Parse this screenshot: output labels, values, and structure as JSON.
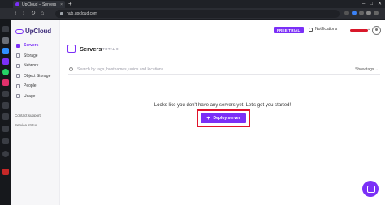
{
  "browser": {
    "tab_title": "UpCloud – Servers",
    "tab_close": "×",
    "new_tab": "+",
    "url": "hub.upcloud.com",
    "win_minimize": "–",
    "win_maximize": "□",
    "win_close": "✕",
    "back": "‹",
    "forward": "›",
    "reload": "↻",
    "home": "⌂"
  },
  "sidebar": {
    "brand": "UpCloud",
    "items": [
      {
        "label": "Servers",
        "active": true
      },
      {
        "label": "Storage",
        "active": false
      },
      {
        "label": "Network",
        "active": false
      },
      {
        "label": "Object Storage",
        "active": false
      },
      {
        "label": "People",
        "active": false
      },
      {
        "label": "Usage",
        "active": false
      }
    ],
    "contact": "Contact support",
    "status": "Service status"
  },
  "header": {
    "badge": "FREE TRIAL",
    "notifications": "Notifications",
    "chevron": "⌄"
  },
  "main": {
    "title": "Servers",
    "total": "TOTAL 0",
    "search_placeholder": "Search by tags, hostnames, uuids and locations",
    "show_tags": "Show tags ⌄",
    "empty_message": "Looks like you don't have any servers yet. Let's get you started!",
    "deploy_label": "Deploy server",
    "deploy_plus": "+"
  },
  "colors": {
    "accent": "#7b2ff7",
    "highlight_outline": "#e0142b",
    "opera_red": "#ff1b2d"
  }
}
